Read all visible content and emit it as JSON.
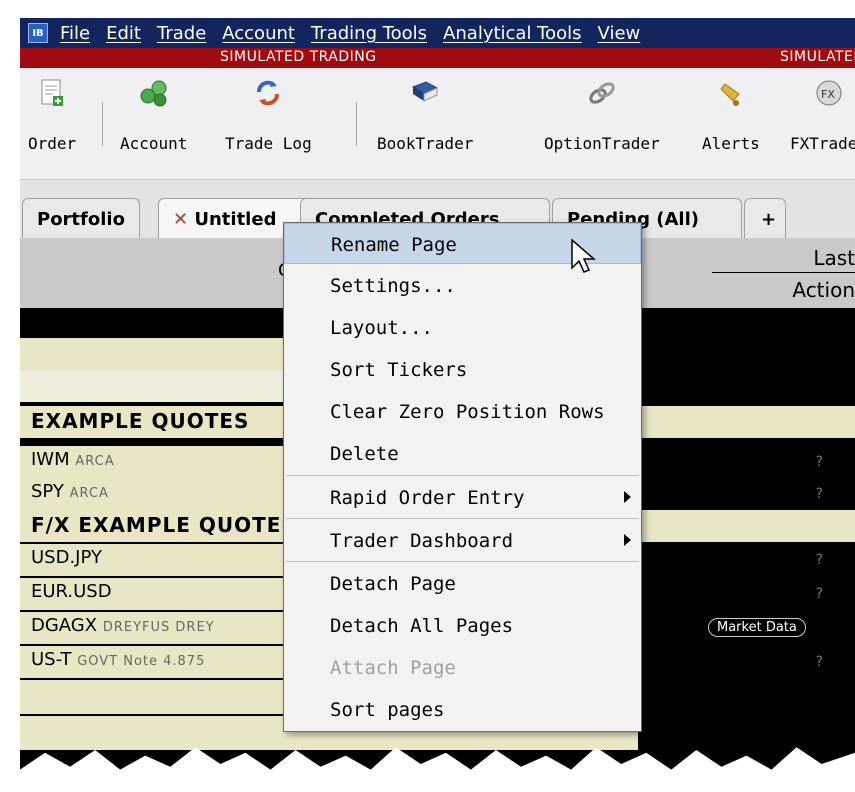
{
  "menubar": {
    "logo": "IB",
    "items": [
      "File",
      "Edit",
      "Trade",
      "Account",
      "Trading Tools",
      "Analytical Tools",
      "View"
    ]
  },
  "banner": {
    "left": "SIMULATED TRADING",
    "right": "SIMULATED"
  },
  "toolbar": {
    "items": [
      {
        "label": "Order",
        "icon": "order-icon"
      },
      {
        "label": "Account",
        "icon": "account-icon"
      },
      {
        "label": "Trade Log",
        "icon": "trade-log-icon"
      },
      {
        "label": "BookTrader",
        "icon": "book-icon"
      },
      {
        "label": "OptionTrader",
        "icon": "option-icon"
      },
      {
        "label": "Alerts",
        "icon": "bell-icon"
      },
      {
        "label": "FXTrader",
        "icon": "fx-icon"
      }
    ]
  },
  "tabs": {
    "items": [
      "Portfolio",
      "Untitled",
      "Completed Orders",
      "Pending (All)",
      "+"
    ],
    "close_mark": "✕"
  },
  "column_header": {
    "last": "Last",
    "action": "Action",
    "left_partial": "C"
  },
  "rows": [
    {
      "symbol": "",
      "exchange": "",
      "type": "blank"
    },
    {
      "symbol": "",
      "exchange": "",
      "type": "blank"
    },
    {
      "symbol": "EXAMPLE QUOTES",
      "exchange": "",
      "type": "header"
    },
    {
      "symbol": "IWM",
      "exchange": "ARCA",
      "type": "quote",
      "mark": "?"
    },
    {
      "symbol": "SPY",
      "exchange": "ARCA",
      "type": "quote",
      "mark": "?"
    },
    {
      "symbol": "F/X EXAMPLE QUOTES",
      "exchange": "",
      "type": "header"
    },
    {
      "symbol": "USD.JPY",
      "exchange": "",
      "type": "quote",
      "mark": "?"
    },
    {
      "symbol": "EUR.USD",
      "exchange": "",
      "type": "quote",
      "mark": "?"
    },
    {
      "symbol": "DGAGX",
      "exchange": "DREYFUS DREY",
      "type": "quote",
      "button": "Market Data"
    },
    {
      "symbol": "US-T",
      "exchange": "GOVT Note 4.875",
      "type": "quote",
      "mark": "?"
    }
  ],
  "context_menu": {
    "items": [
      {
        "label": "Rename Page",
        "highlighted": true
      },
      {
        "label": "Settings..."
      },
      {
        "label": "Layout..."
      },
      {
        "label": "Sort Tickers"
      },
      {
        "label": "Clear Zero Position Rows"
      },
      {
        "label": "Delete"
      },
      {
        "label": "Rapid Order Entry",
        "submenu": true
      },
      {
        "label": "Trader Dashboard",
        "submenu": true
      },
      {
        "label": "Detach Page"
      },
      {
        "label": "Detach All Pages"
      },
      {
        "label": "Attach Page",
        "disabled": true
      },
      {
        "label": "Sort pages"
      }
    ]
  },
  "colors": {
    "menubar": "#12255c",
    "banner": "#a00b12",
    "grid_light": "#e9e6c6",
    "grid_dark": "#000000",
    "highlight": "#c8d6e9"
  }
}
